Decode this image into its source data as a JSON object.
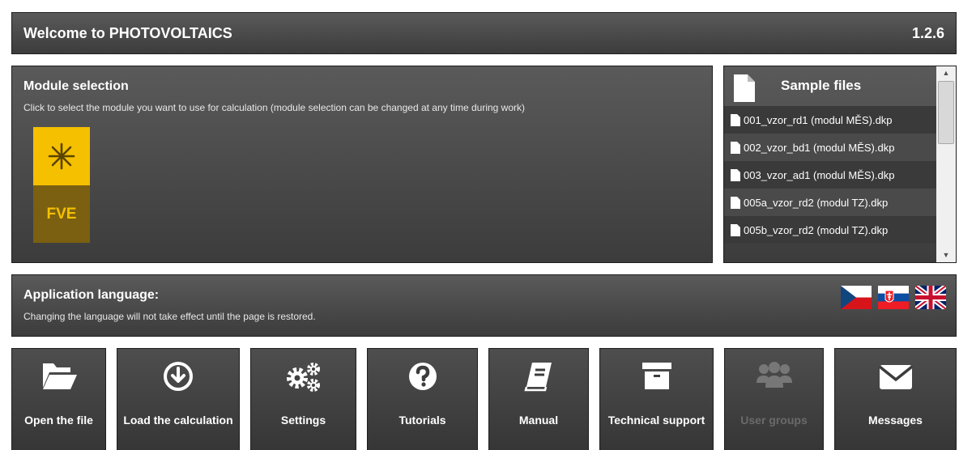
{
  "header": {
    "title": "Welcome to PHOTOVOLTAICS",
    "version": "1.2.6"
  },
  "module_selection": {
    "heading": "Module selection",
    "description": "Click to select the module you want to use for calculation (module selection can be changed at any time during work)",
    "modules": [
      {
        "label": "FVE",
        "icon": "asterisk-icon",
        "accent": "#f5c000"
      }
    ]
  },
  "samples": {
    "heading": "Sample files",
    "files": [
      "001_vzor_rd1 (modul MĚS).dkp",
      "002_vzor_bd1 (modul MĚS).dkp",
      "003_vzor_ad1 (modul MĚS).dkp",
      "005a_vzor_rd2 (modul TZ).dkp",
      "005b_vzor_rd2 (modul TZ).dkp"
    ]
  },
  "language": {
    "heading": "Application language:",
    "description": "Changing the language will not take effect until the page is restored.",
    "flags": [
      "czech-flag",
      "slovak-flag",
      "uk-flag"
    ]
  },
  "toolbar": {
    "open_label": "Open the file",
    "load_label": "Load the calculation",
    "settings_label": "Settings",
    "tutorials_label": "Tutorials",
    "manual_label": "Manual",
    "support_label": "Technical support",
    "groups_label": "User groups",
    "messages_label": "Messages"
  }
}
